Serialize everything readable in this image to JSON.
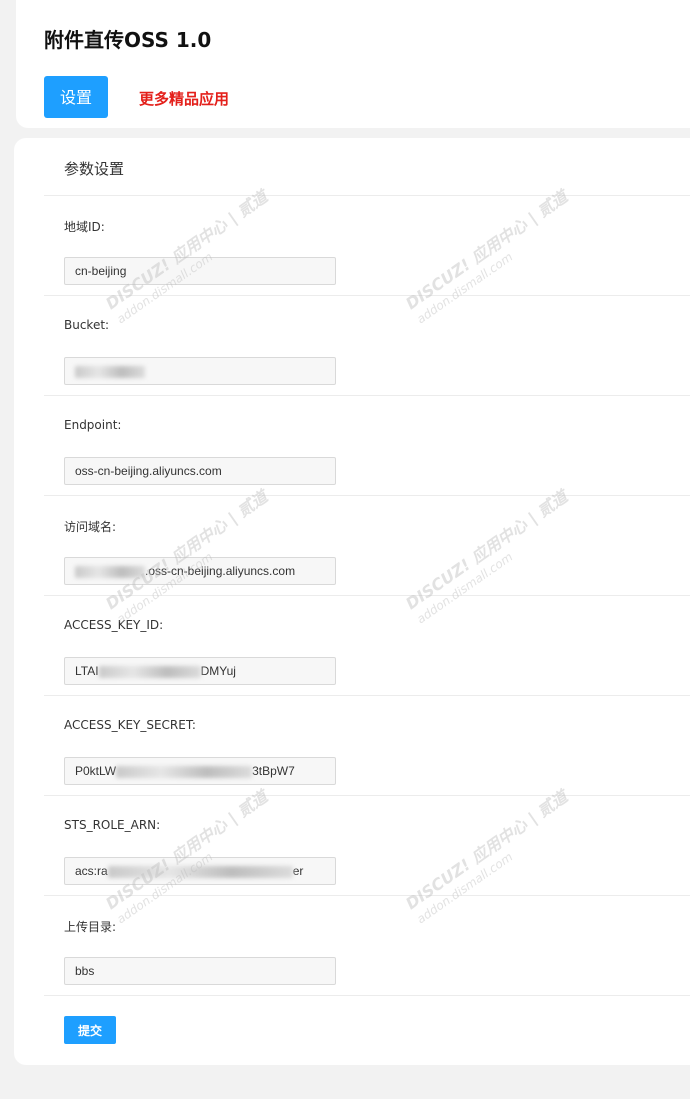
{
  "header": {
    "title": "附件直传OSS 1.0",
    "settings_label": "设置",
    "more_apps_label": "更多精品应用"
  },
  "panel": {
    "title": "参数设置",
    "fields": [
      {
        "label": "地域ID:",
        "value": "cn-beijing"
      },
      {
        "label": "Bucket:",
        "value": ""
      },
      {
        "label": "Endpoint:",
        "value": "oss-cn-beijing.aliyuncs.com"
      },
      {
        "label": "访问域名:",
        "value_suffix": ".oss-cn-beijing.aliyuncs.com"
      },
      {
        "label": "ACCESS_KEY_ID:",
        "value_prefix": "LTAI",
        "value_suffix": "DMYuj"
      },
      {
        "label": "ACCESS_KEY_SECRET:",
        "value_prefix": "P0ktLW",
        "value_suffix": "3tBpW7"
      },
      {
        "label": "STS_ROLE_ARN:",
        "value_prefix": "acs:ra",
        "value_suffix": "er"
      },
      {
        "label": "上传目录:",
        "value": "bbs"
      }
    ],
    "submit_label": "提交"
  },
  "watermark": {
    "brand": "DISCUZ!",
    "cn": "应用中心 | 贰道",
    "site": "addon.dismall.com"
  },
  "colors": {
    "primary": "#1e9fff",
    "link_red": "#e4201b"
  }
}
